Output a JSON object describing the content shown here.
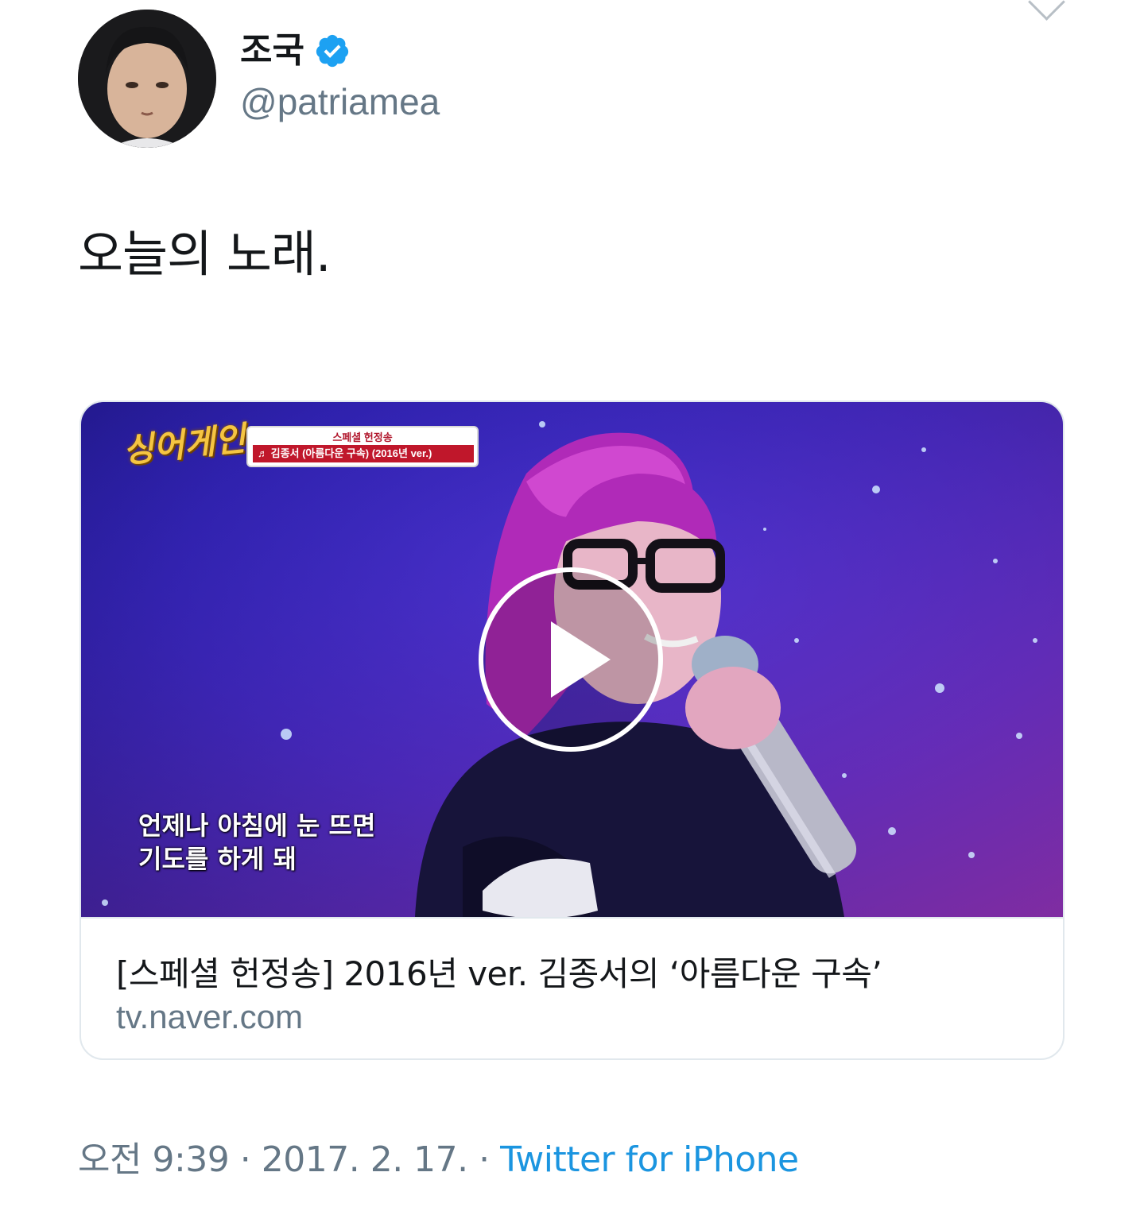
{
  "tweet": {
    "display_name": "조국",
    "handle": "@patriamea",
    "verified": true,
    "text": "오늘의 노래.",
    "time": "오전 9:39",
    "date": "2017. 2. 17.",
    "separator": "·",
    "source": "Twitter for iPhone"
  },
  "card": {
    "video_overlay": {
      "show_logo": "싱어게인",
      "badge_top": "스페셜 헌정송",
      "badge_bottom": "♬ 김종서 (아름다운 구속) (2016년 ver.)",
      "subtitle_line1": "언제나 아침에 눈 뜨면",
      "subtitle_line2": "기도를 하게 돼"
    },
    "title": "[스페셜 헌정송] 2016년 ver. 김종서의 ‘아름다운 구속’",
    "domain": "tv.naver.com"
  },
  "icons": {
    "verified": "verified-badge-icon",
    "play": "play-icon",
    "caret": "chevron-down-icon"
  },
  "colors": {
    "link_blue": "#1b95e0",
    "verified_blue": "#1da1f2",
    "secondary_text": "#657786",
    "primary_text": "#14171a",
    "border": "#e1e8ed"
  }
}
